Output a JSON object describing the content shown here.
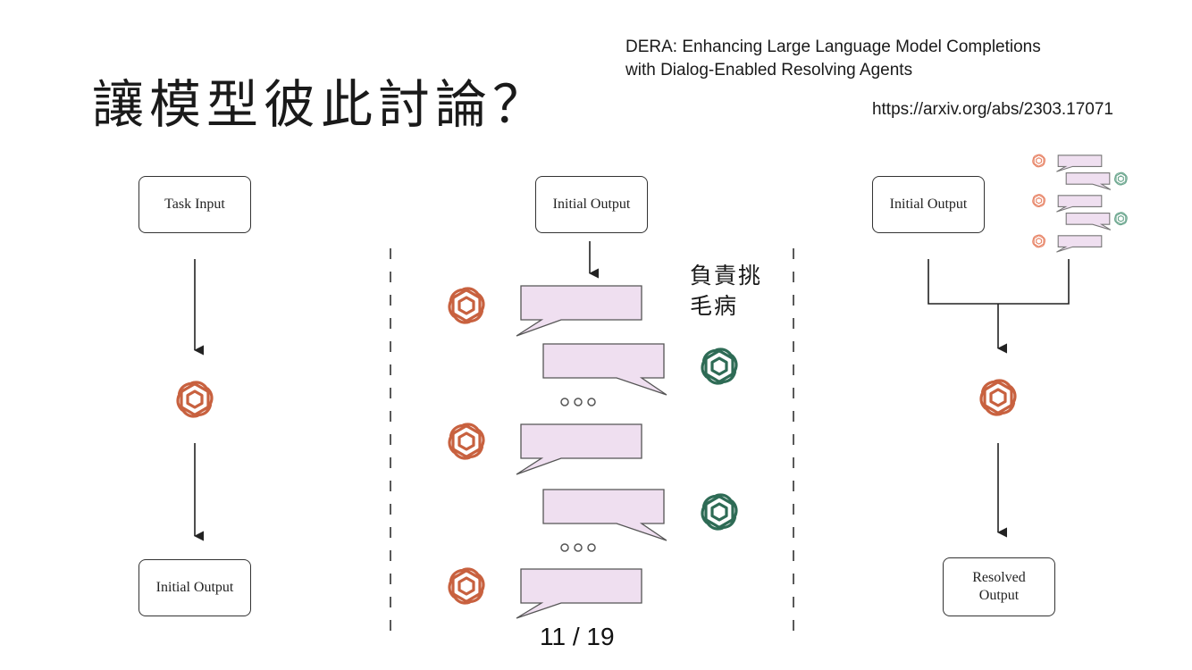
{
  "slide": {
    "title": "讓模型彼此討論？",
    "reference_line1": "DERA: Enhancing Large Language Model Completions",
    "reference_line2": "with Dialog-Enabled Resolving Agents",
    "url": "https://arxiv.org/abs/2303.17071",
    "page_number": "11 / 19"
  },
  "left_panel": {
    "task_input": "Task Input",
    "initial_output": "Initial Output"
  },
  "middle_panel": {
    "initial_output": "Initial Output",
    "critic_label_line1": "負責挑",
    "critic_label_line2": "毛病",
    "ellipsis": "ooo"
  },
  "right_panel": {
    "initial_output": "Initial Output",
    "resolved_output_line1": "Resolved",
    "resolved_output_line2": "Output"
  },
  "colors": {
    "orange_agent": "#c8613f",
    "green_agent": "#2e6b55",
    "bubble_fill": "#efdff0",
    "line": "#222222"
  },
  "icons": [
    "openai-logo-icon"
  ]
}
